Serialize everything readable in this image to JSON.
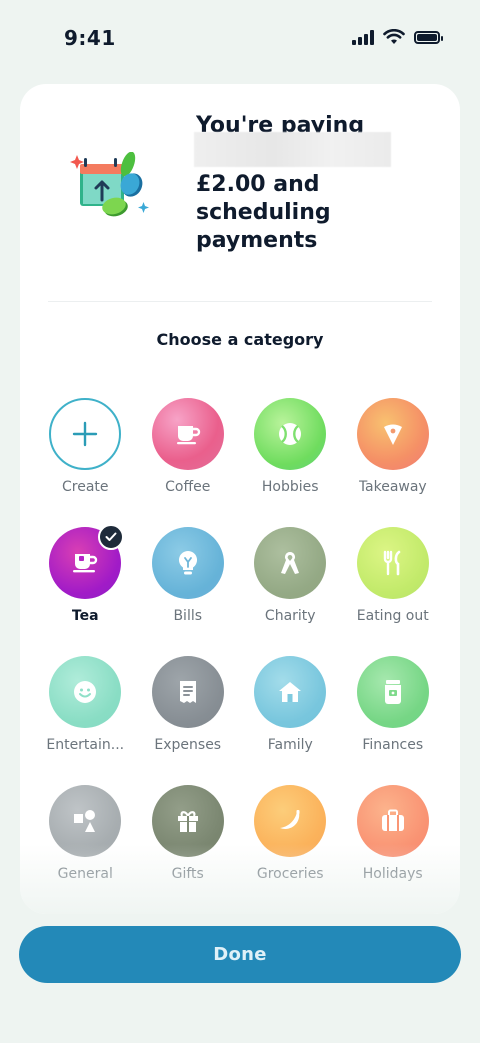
{
  "status_bar": {
    "time": "9:41"
  },
  "header": {
    "line1": "You're paying",
    "amount_line": "£2.00 and",
    "line3": "scheduling",
    "line4": "payments"
  },
  "section_title": "Choose a category",
  "categories": [
    {
      "label": "Create",
      "icon": "plus-icon",
      "selected": false
    },
    {
      "label": "Coffee",
      "icon": "coffee-cup-icon",
      "color": "#ee6f9a",
      "selected": false
    },
    {
      "label": "Hobbies",
      "icon": "tennis-ball-icon",
      "color": "#7ee06f",
      "selected": false
    },
    {
      "label": "Takeaway",
      "icon": "pizza-slice-icon",
      "color": "#f3926b",
      "selected": false
    },
    {
      "label": "Tea",
      "icon": "tea-cup-icon",
      "color": "#b324c4",
      "selected": true
    },
    {
      "label": "Bills",
      "icon": "lightbulb-icon",
      "color": "#6fb6d9",
      "selected": false
    },
    {
      "label": "Charity",
      "icon": "ribbon-icon",
      "color": "#9aaf8d",
      "selected": false
    },
    {
      "label": "Eating out",
      "icon": "cutlery-icon",
      "color": "#c8ec70",
      "selected": false
    },
    {
      "label": "Entertain...",
      "icon": "smiley-icon",
      "color": "#8fe0c8",
      "selected": false
    },
    {
      "label": "Expenses",
      "icon": "receipt-icon",
      "color": "#8c9399",
      "selected": false
    },
    {
      "label": "Family",
      "icon": "house-icon",
      "color": "#7fcadf",
      "selected": false
    },
    {
      "label": "Finances",
      "icon": "money-jar-icon",
      "color": "#7fda8c",
      "selected": false
    },
    {
      "label": "General",
      "icon": "shapes-icon",
      "color": "#a9afb2",
      "selected": false
    },
    {
      "label": "Gifts",
      "icon": "gift-icon",
      "color": "#7e8a74",
      "selected": false
    },
    {
      "label": "Groceries",
      "icon": "banana-icon",
      "color": "#fbb25b",
      "selected": false
    },
    {
      "label": "Holidays",
      "icon": "suitcase-icon",
      "color": "#fa9675",
      "selected": false
    }
  ],
  "done_button": {
    "label": "Done"
  }
}
